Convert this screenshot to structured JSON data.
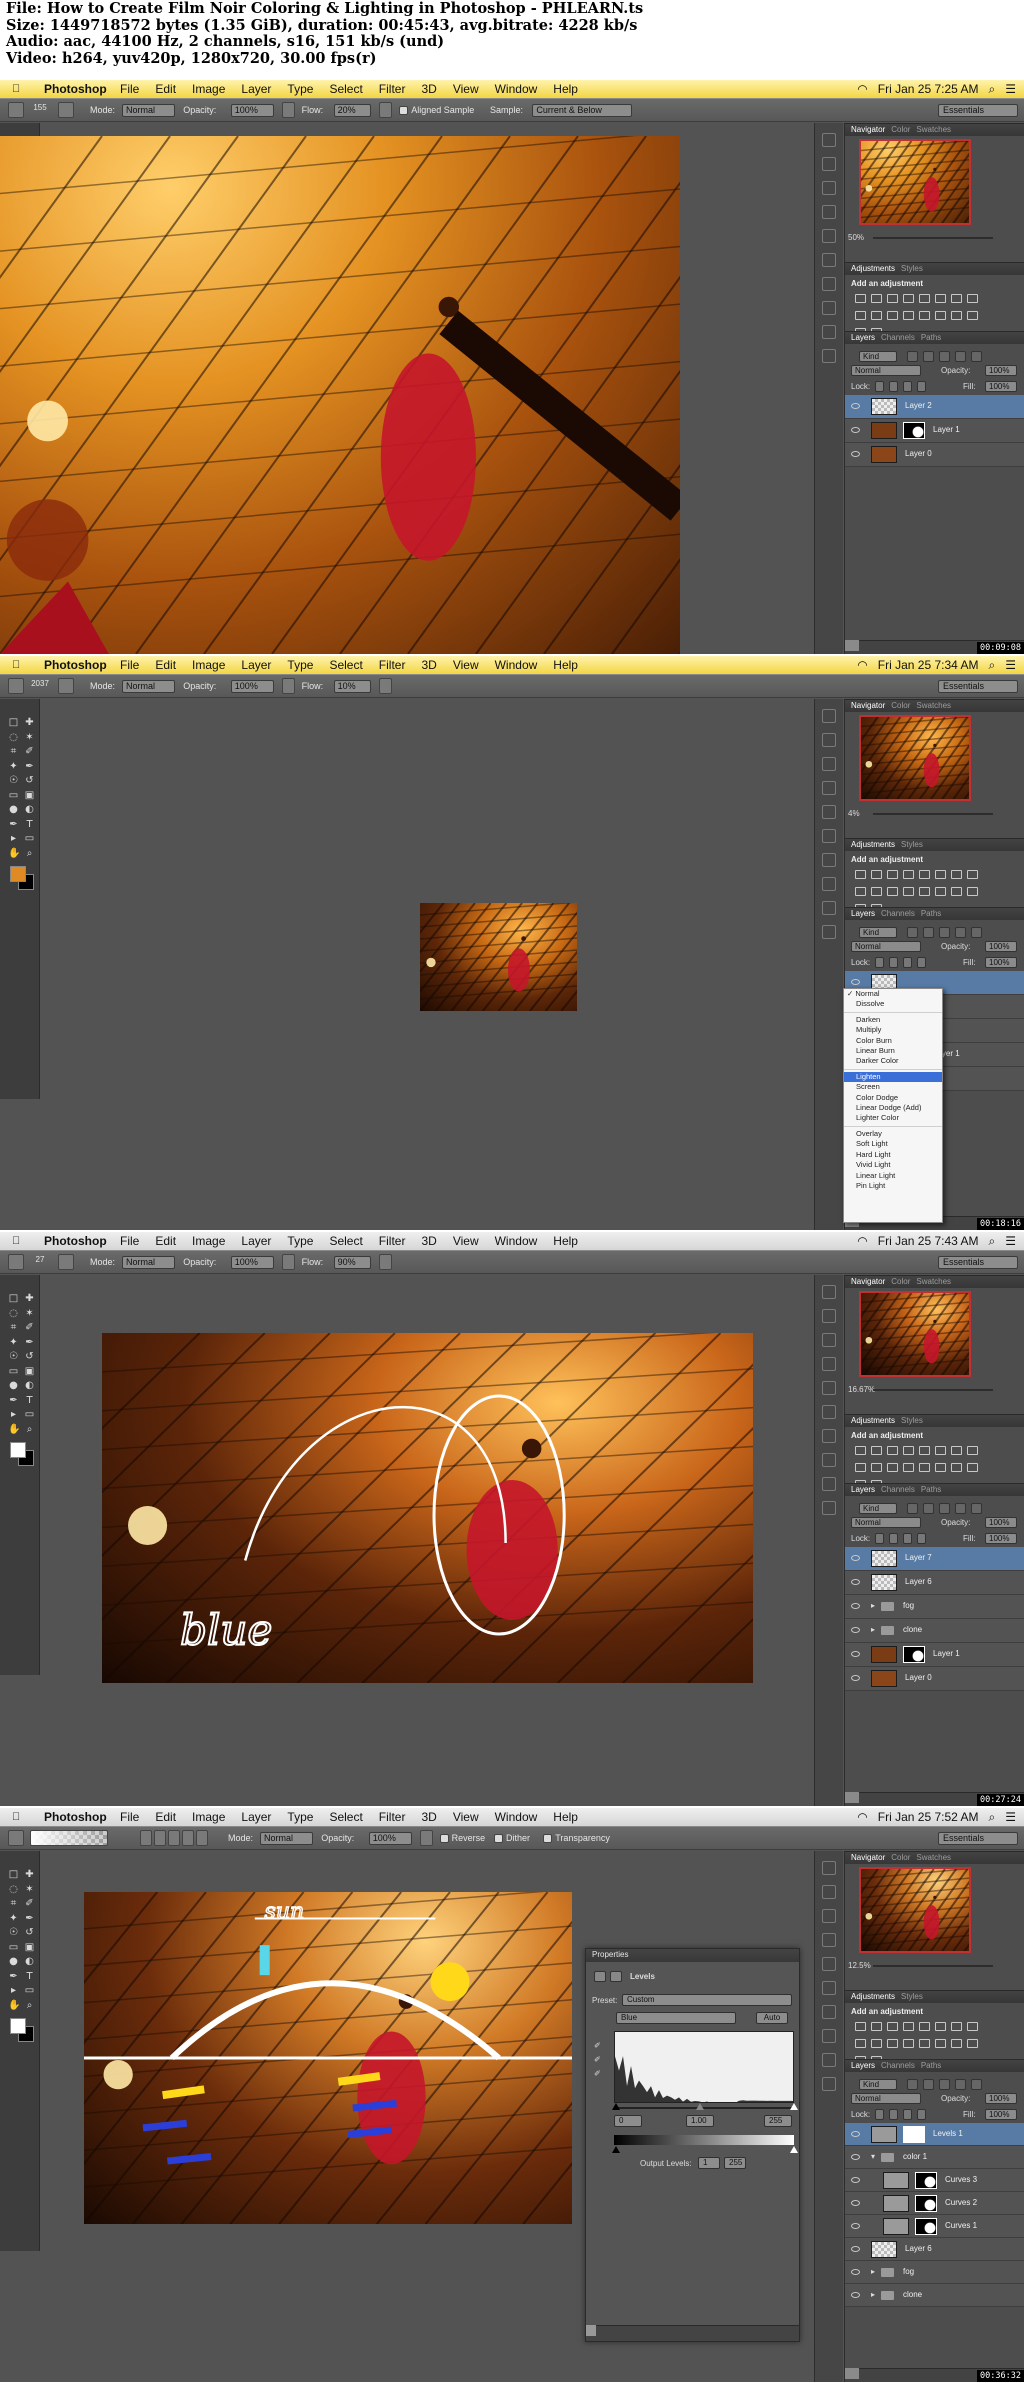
{
  "header": {
    "file_line": "File: How to Create Film Noir Coloring & Lighting in Photoshop - PHLEARN.ts",
    "size_line": "Size: 1449718572 bytes (1.35 GiB), duration: 00:45:43, avg.bitrate: 4228 kb/s",
    "audio_line": "Audio: aac, 44100 Hz, 2 channels, s16, 151 kb/s (und)",
    "video_line": "Video: h264, yuv420p, 1280x720, 30.00 fps(r)"
  },
  "app": {
    "name": "Photoshop",
    "menus": [
      "File",
      "Edit",
      "Image",
      "Layer",
      "Type",
      "Select",
      "Filter",
      "3D",
      "View",
      "Window",
      "Help"
    ],
    "apple_glyph": "",
    "wifi_glyph": "◠",
    "search_glyph": "⌕",
    "list_glyph": "☰",
    "workspace": "Essentials"
  },
  "frames": [
    {
      "clock": "Fri Jan 25  7:25 AM",
      "timestamp": "00:09:08",
      "menubar_color": "#f3d644",
      "options": [
        {
          "t": "Mode:"
        },
        {
          "d": "Normal"
        },
        {
          "t": "Opacity:"
        },
        {
          "d": "100%"
        },
        {
          "t": "Flow:"
        },
        {
          "d": "20%"
        },
        {
          "t": "Aligned Sample"
        },
        {
          "t": "Sample:"
        },
        {
          "d": "Current & Below"
        }
      ],
      "brush_size": "155",
      "zoom": "50%",
      "panels": {
        "nav_tabs": [
          "Navigator",
          "Color",
          "Swatches"
        ],
        "adj_tabs": [
          "Adjustments",
          "Styles"
        ],
        "add_adjustment": "Add an adjustment",
        "layer_tabs": [
          "Layers",
          "Channels",
          "Paths"
        ],
        "kind": "Kind",
        "blend": "Normal",
        "opacity_label": "Opacity:",
        "opacity": "100%",
        "lock_label": "Lock:",
        "fill_label": "Fill:",
        "fill": "100%",
        "layers": [
          {
            "name": "Layer 2",
            "selected": true,
            "thumb": "#d8d8d8",
            "mask": false
          },
          {
            "name": "Layer 1",
            "selected": false,
            "thumb": "#7a3c14",
            "mask": true
          },
          {
            "name": "Layer 0",
            "selected": false,
            "thumb": "#8a4518",
            "mask": false
          }
        ]
      }
    },
    {
      "clock": "Fri Jan 25  7:34 AM",
      "timestamp": "00:18:16",
      "menubar_color": "#f3d644",
      "options": [
        {
          "t": "Mode:"
        },
        {
          "d": "Normal"
        },
        {
          "t": "Opacity:"
        },
        {
          "d": "100%"
        },
        {
          "t": "Flow:"
        },
        {
          "d": "10%"
        }
      ],
      "brush_size": "2037",
      "zoom": "4%",
      "panels": {
        "nav_tabs": [
          "Navigator",
          "Color",
          "Swatches"
        ],
        "adj_tabs": [
          "Adjustments",
          "Styles"
        ],
        "add_adjustment": "Add an adjustment",
        "layer_tabs": [
          "Layers",
          "Channels",
          "Paths"
        ],
        "kind": "Kind",
        "blend": "Normal",
        "opacity_label": "Opacity:",
        "opacity": "100%",
        "lock_label": "Lock:",
        "fill_label": "Fill:",
        "fill": "100%",
        "layers": [
          {
            "name": "",
            "selected": true,
            "thumb": "#d8d8d8",
            "mask": false
          },
          {
            "name": "",
            "selected": false,
            "thumb": "#7a3c14",
            "mask": false
          },
          {
            "name": "",
            "selected": false,
            "thumb": "#7a3c14",
            "mask": false
          },
          {
            "name": "Layer 1",
            "selected": false,
            "thumb": "#7a3c14",
            "mask": true
          },
          {
            "name": "",
            "selected": false,
            "thumb": "#8a4518",
            "mask": false
          }
        ],
        "blend_menu": {
          "groups": [
            [
              "Normal",
              "Dissolve"
            ],
            [
              "Darken",
              "Multiply",
              "Color Burn",
              "Linear Burn",
              "Darker Color"
            ],
            [
              "Lighten",
              "Screen",
              "Color Dodge",
              "Linear Dodge (Add)",
              "Lighter Color"
            ],
            [
              "Overlay",
              "Soft Light",
              "Hard Light",
              "Vivid Light",
              "Linear Light",
              "Pin Light"
            ]
          ],
          "checked": "Normal",
          "highlighted": "Lighten"
        }
      }
    },
    {
      "clock": "Fri Jan 25  7:43 AM",
      "timestamp": "00:27:24",
      "menubar_color": "#d6d6d6",
      "options": [
        {
          "t": "Mode:"
        },
        {
          "d": "Normal"
        },
        {
          "t": "Opacity:"
        },
        {
          "d": "100%"
        },
        {
          "t": "Flow:"
        },
        {
          "d": "90%"
        }
      ],
      "brush_size": "27",
      "zoom": "16.67%",
      "annotation": "blue",
      "panels": {
        "nav_tabs": [
          "Navigator",
          "Color",
          "Swatches"
        ],
        "adj_tabs": [
          "Adjustments",
          "Styles"
        ],
        "add_adjustment": "Add an adjustment",
        "layer_tabs": [
          "Layers",
          "Channels",
          "Paths"
        ],
        "kind": "Kind",
        "blend": "Normal",
        "opacity_label": "Opacity:",
        "opacity": "100%",
        "lock_label": "Lock:",
        "fill_label": "Fill:",
        "fill": "100%",
        "layers": [
          {
            "name": "Layer 7",
            "selected": true,
            "thumb": "#d8d8d8",
            "mask": false
          },
          {
            "name": "Layer 6",
            "selected": false,
            "thumb": "#d8d8d8",
            "mask": false
          },
          {
            "name": "fog",
            "selected": false,
            "folder": true
          },
          {
            "name": "clone",
            "selected": false,
            "folder": true
          },
          {
            "name": "Layer 1",
            "selected": false,
            "thumb": "#7a3c14",
            "mask": true
          },
          {
            "name": "Layer 0",
            "selected": false,
            "thumb": "#8a4518",
            "mask": false
          }
        ]
      }
    },
    {
      "clock": "Fri Jan 25  7:52 AM",
      "timestamp": "00:36:32",
      "menubar_color": "#d6d6d6",
      "options": [
        {
          "t": "Mode:"
        },
        {
          "d": "Normal"
        },
        {
          "t": "Opacity:"
        },
        {
          "d": "100%"
        },
        {
          "t": "Reverse"
        },
        {
          "t": "Dither"
        },
        {
          "t": "Transparency"
        }
      ],
      "brush_size": "",
      "zoom": "12.5%",
      "annotation": "sun",
      "panels": {
        "nav_tabs": [
          "Navigator",
          "Color",
          "Swatches"
        ],
        "adj_tabs": [
          "Adjustments",
          "Styles"
        ],
        "add_adjustment": "Add an adjustment",
        "layer_tabs": [
          "Layers",
          "Channels",
          "Paths"
        ],
        "kind": "Kind",
        "blend": "Normal",
        "opacity_label": "Opacity:",
        "opacity": "100%",
        "lock_label": "Lock:",
        "fill_label": "Fill:",
        "fill": "100%",
        "layers": [
          {
            "name": "Levels 1",
            "selected": true,
            "thumb": "#9a9a9a",
            "mask": true,
            "white_mask": true
          },
          {
            "name": "color 1",
            "selected": false,
            "folder": true,
            "open": true
          },
          {
            "name": "Curves 3",
            "selected": false,
            "thumb": "#9a9a9a",
            "mask": true,
            "indent": true
          },
          {
            "name": "Curves 2",
            "selected": false,
            "thumb": "#9a9a9a",
            "mask": true,
            "indent": true
          },
          {
            "name": "Curves 1",
            "selected": false,
            "thumb": "#9a9a9a",
            "mask": true,
            "indent": true
          },
          {
            "name": "Layer 6",
            "selected": false,
            "thumb": "#d8d8d8",
            "mask": false
          },
          {
            "name": "fog",
            "selected": false,
            "folder": true
          },
          {
            "name": "clone",
            "selected": false,
            "folder": true
          }
        ],
        "properties": {
          "title": "Properties",
          "section": "Levels",
          "preset_label": "Preset:",
          "preset": "Custom",
          "channel": "Blue",
          "auto": "Auto",
          "input_black": "0",
          "input_gamma": "1.00",
          "input_white": "255",
          "output_label": "Output Levels:",
          "output_black": "1",
          "output_white": "255"
        }
      }
    }
  ]
}
